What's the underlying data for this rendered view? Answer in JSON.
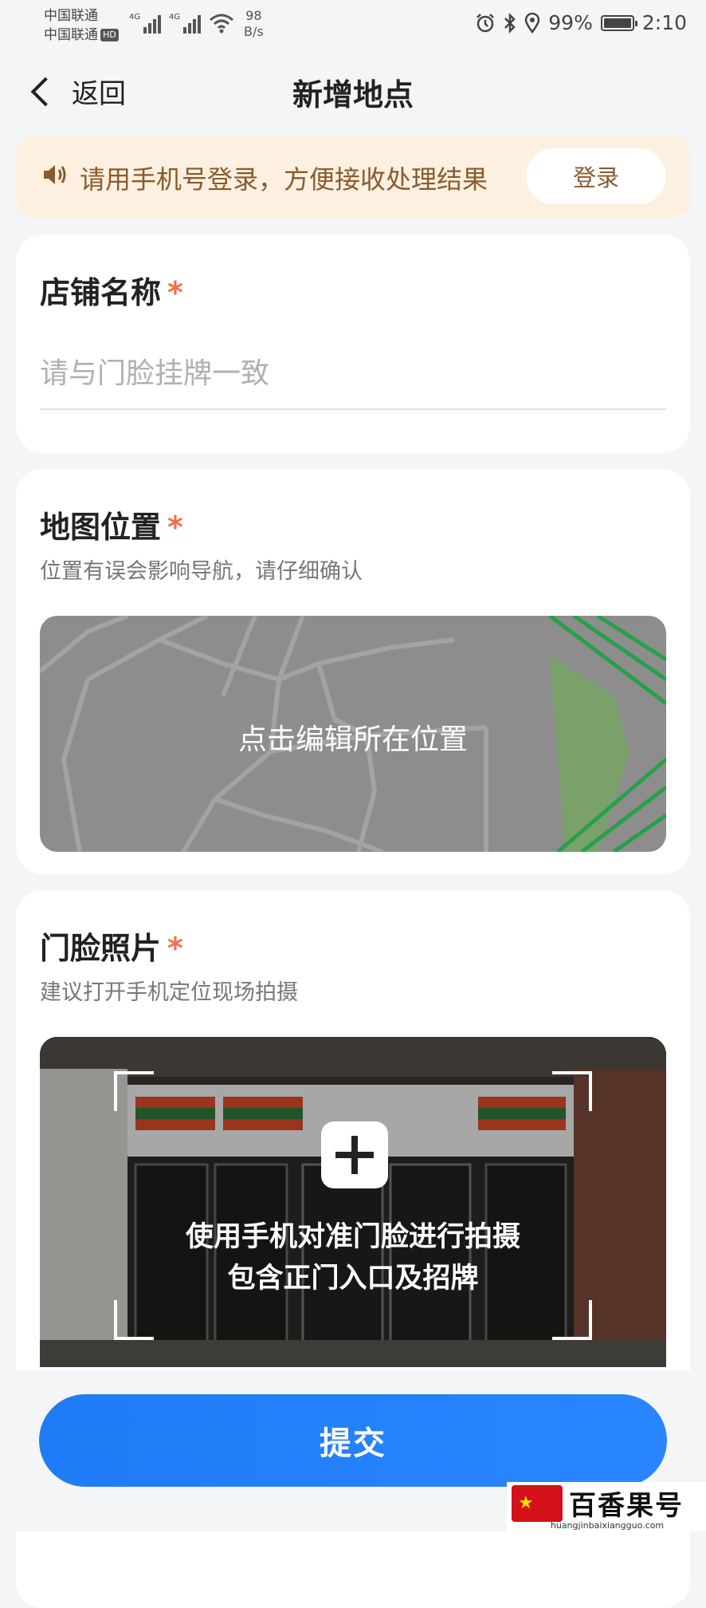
{
  "status_bar": {
    "carrier1": "中国联通",
    "carrier2": "中国联通",
    "hd": "HD",
    "network1": "4G",
    "network2": "4G",
    "speed_value": "98",
    "speed_unit": "B/s",
    "battery_percent": "99%",
    "battery_level": 0.99,
    "time": "2:10"
  },
  "header": {
    "back_label": "返回",
    "title": "新增地点"
  },
  "notice": {
    "text": "请用手机号登录，方便接收处理结果",
    "login_label": "登录"
  },
  "store_name": {
    "label": "店铺名称",
    "required_mark": "*",
    "placeholder": "请与门脸挂牌一致",
    "value": ""
  },
  "map_location": {
    "label": "地图位置",
    "required_mark": "*",
    "hint": "位置有误会影响导航，请仔细确认",
    "map_action": "点击编辑所在位置"
  },
  "storefront_photo": {
    "label": "门脸照片",
    "required_mark": "*",
    "hint": "建议打开手机定位现场拍摄",
    "instruction_line1": "使用手机对准门脸进行拍摄",
    "instruction_line2": "包含正门入口及招牌"
  },
  "submit_label": "提交",
  "watermark": {
    "name": "百香果号",
    "url": "huangjinbaixiangguo.com"
  },
  "colors": {
    "accent": "#1f7cf6",
    "required": "#f36f4a",
    "notice_bg": "#fdf0e0",
    "notice_text": "#8a5a2b"
  }
}
